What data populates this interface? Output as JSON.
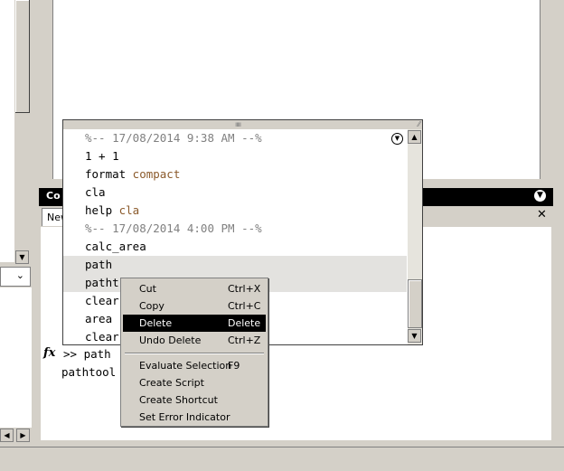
{
  "command_window": {
    "title": "Co",
    "tab_label": "New",
    "close_glyph": "✕",
    "menu_glyph": "▼",
    "prompt": ">> path",
    "output": "pathtool",
    "fx_label": "fx"
  },
  "history": {
    "lines": [
      {
        "text": "%-- 17/08/2014 9:38 AM --%",
        "kind": "timestamp"
      },
      {
        "cmd": "1 + 1",
        "arg": ""
      },
      {
        "cmd": "format",
        "arg": " compact"
      },
      {
        "cmd": "cla",
        "arg": ""
      },
      {
        "cmd": "help",
        "arg": " cla"
      },
      {
        "text": "%-- 17/08/2014 4:00 PM --%",
        "kind": "timestamp"
      },
      {
        "cmd": "calc_area",
        "arg": ""
      },
      {
        "cmd": "path",
        "arg": ""
      },
      {
        "cmd": "patht",
        "arg": ""
      },
      {
        "cmd": "clear",
        "arg": ""
      },
      {
        "cmd": "area",
        "arg": ""
      },
      {
        "cmd": "clear",
        "arg": ""
      }
    ],
    "selected_lines": [
      7,
      8
    ],
    "options_glyph": "▼",
    "grip_glyph": "ııııı",
    "resize_glyph": "⁄⁄"
  },
  "context_menu": {
    "items": [
      {
        "label": "Cut",
        "shortcut": "Ctrl+X"
      },
      {
        "label": "Copy",
        "shortcut": "Ctrl+C"
      },
      {
        "label": "Delete",
        "shortcut": "Delete",
        "highlighted": true
      },
      {
        "label": "Undo Delete",
        "shortcut": "Ctrl+Z"
      },
      {
        "separator": true
      },
      {
        "label": "Evaluate Selection",
        "shortcut": "F9"
      },
      {
        "label": "Create Script",
        "shortcut": ""
      },
      {
        "label": "Create Shortcut",
        "shortcut": ""
      },
      {
        "label": "Set Error Indicator",
        "shortcut": ""
      }
    ]
  },
  "icons": {
    "up_arrow": "▲",
    "down_arrow": "▼",
    "left_arrow": "◀",
    "right_arrow": "▶",
    "chevron_down": "⌄"
  },
  "colors": {
    "chrome": "#d4d0c8",
    "titlebar": "#000000",
    "selection": "#e3e2df",
    "menu_highlight": "#000000",
    "timestamp": "#808080",
    "argument": "#8b5a2b"
  }
}
